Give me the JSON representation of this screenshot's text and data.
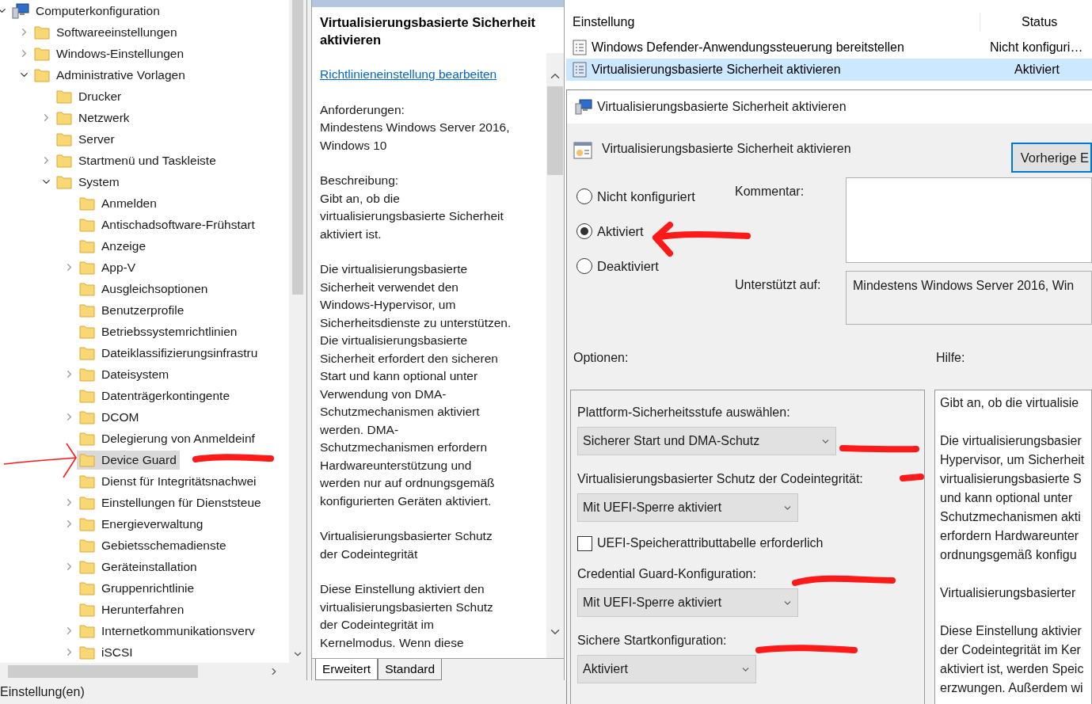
{
  "tree": {
    "items": [
      {
        "label": "Computerkonfiguration",
        "kind": "computer",
        "expanded": true,
        "selected": false,
        "children": [
          {
            "label": "Softwareeinstellungen",
            "kind": "folder",
            "expanded": false,
            "selected": false
          },
          {
            "label": "Windows-Einstellungen",
            "kind": "folder",
            "expanded": false,
            "selected": false
          },
          {
            "label": "Administrative Vorlagen",
            "kind": "folder",
            "expanded": true,
            "selected": false,
            "children": [
              {
                "label": "Drucker",
                "kind": "folder",
                "selected": false
              },
              {
                "label": "Netzwerk",
                "kind": "folder",
                "expanded": false,
                "selected": false
              },
              {
                "label": "Server",
                "kind": "folder",
                "selected": false
              },
              {
                "label": "Startmenü und Taskleiste",
                "kind": "folder",
                "expanded": false,
                "selected": false
              },
              {
                "label": "System",
                "kind": "folder",
                "expanded": true,
                "selected": false,
                "children": [
                  {
                    "label": "Anmelden",
                    "kind": "folder",
                    "selected": false
                  },
                  {
                    "label": "Antischadsoftware-Frühstart",
                    "kind": "folder",
                    "selected": false
                  },
                  {
                    "label": "Anzeige",
                    "kind": "folder",
                    "selected": false
                  },
                  {
                    "label": "App-V",
                    "kind": "folder",
                    "expanded": false,
                    "selected": false
                  },
                  {
                    "label": "Ausgleichsoptionen",
                    "kind": "folder",
                    "selected": false
                  },
                  {
                    "label": "Benutzerprofile",
                    "kind": "folder",
                    "selected": false
                  },
                  {
                    "label": "Betriebssystemrichtlinien",
                    "kind": "folder",
                    "selected": false
                  },
                  {
                    "label": "Dateiklassifizierungsinfrastru",
                    "kind": "folder",
                    "selected": false
                  },
                  {
                    "label": "Dateisystem",
                    "kind": "folder",
                    "expanded": false,
                    "selected": false
                  },
                  {
                    "label": "Datenträgerkontingente",
                    "kind": "folder",
                    "selected": false
                  },
                  {
                    "label": "DCOM",
                    "kind": "folder",
                    "expanded": false,
                    "selected": false
                  },
                  {
                    "label": "Delegierung von Anmeldeinf",
                    "kind": "folder",
                    "selected": false
                  },
                  {
                    "label": "Device Guard",
                    "kind": "folder",
                    "selected": true
                  },
                  {
                    "label": "Dienst für Integritätsnachwei",
                    "kind": "folder",
                    "selected": false
                  },
                  {
                    "label": "Einstellungen für Dienststeue",
                    "kind": "folder",
                    "expanded": false,
                    "selected": false
                  },
                  {
                    "label": "Energieverwaltung",
                    "kind": "folder",
                    "expanded": false,
                    "selected": false
                  },
                  {
                    "label": "Gebietsschemadienste",
                    "kind": "folder",
                    "selected": false
                  },
                  {
                    "label": "Geräteinstallation",
                    "kind": "folder",
                    "expanded": false,
                    "selected": false
                  },
                  {
                    "label": "Gruppenrichtlinie",
                    "kind": "folder",
                    "selected": false
                  },
                  {
                    "label": "Herunterfahren",
                    "kind": "folder",
                    "selected": false
                  },
                  {
                    "label": "Internetkommunikationsverv",
                    "kind": "folder",
                    "expanded": false,
                    "selected": false
                  },
                  {
                    "label": "iSCSI",
                    "kind": "folder",
                    "expanded": false,
                    "selected": false
                  }
                ]
              }
            ]
          }
        ]
      }
    ]
  },
  "status_bar": "Einstellung(en)",
  "explain": {
    "title": "Virtualisierungsbasierte Sicherheit aktivieren",
    "link": "Richtlinieneinstellung bearbeiten",
    "paragraphs": [
      "Anforderungen:\nMindestens Windows Server 2016,\nWindows 10",
      "Beschreibung:\nGibt an, ob die\nvirtualisierungsbasierte Sicherheit\naktiviert ist.",
      "Die virtualisierungsbasierte\nSicherheit verwendet den\nWindows-Hypervisor, um\nSicherheitsdienste zu unterstützen.\nDie virtualisierungsbasierte\nSicherheit erfordert den sicheren\nStart und kann optional unter\nVerwendung von DMA-\nSchutzmechanismen aktiviert\nwerden. DMA-\nSchutzmechanismen erfordern\nHardwareunterstützung und\nwerden nur auf ordnungsgemäß\nkonfigurierten Geräten aktiviert.",
      "Virtualisierungsbasierter Schutz\nder Codeintegrität",
      "Diese Einstellung aktiviert den\nvirtualisierungsbasierten Schutz\nder Codeintegrität im\nKernelmodus. Wenn diese"
    ],
    "tabs": [
      {
        "label": "Erweitert",
        "selected": true
      },
      {
        "label": "Standard",
        "selected": false
      }
    ]
  },
  "settings_list": {
    "columns": [
      "Einstellung",
      "Status"
    ],
    "rows": [
      {
        "name": "Windows Defender-Anwendungssteuerung bereitstellen",
        "status": "Nicht konfiguri…",
        "selected": false
      },
      {
        "name": "Virtualisierungsbasierte Sicherheit aktivieren",
        "status": "Aktiviert",
        "selected": true
      }
    ]
  },
  "dialog": {
    "title": "Virtualisierungsbasierte Sicherheit aktivieren",
    "setting_name": "Virtualisierungsbasierte Sicherheit aktivieren",
    "previous_button": "Vorherige E",
    "states": [
      {
        "label": "Nicht konfiguriert",
        "selected": false
      },
      {
        "label": "Aktiviert",
        "selected": true
      },
      {
        "label": "Deaktiviert",
        "selected": false
      }
    ],
    "comment_label": "Kommentar:",
    "supported_label": "Unterstützt auf:",
    "supported_value": "Mindestens Windows Server 2016, Win",
    "options_label": "Optionen:",
    "help_label": "Hilfe:",
    "options": [
      {
        "kind": "label",
        "text": "Plattform-Sicherheitsstufe auswählen:"
      },
      {
        "kind": "dropdown",
        "value": "Sicherer Start und DMA-Schutz"
      },
      {
        "kind": "label",
        "text": "Virtualisierungsbasierter Schutz der Codeintegrität:"
      },
      {
        "kind": "dropdown",
        "value": "Mit UEFI-Sperre aktiviert"
      },
      {
        "kind": "checkbox",
        "label": "UEFI-Speicherattributtabelle erforderlich",
        "checked": false
      },
      {
        "kind": "label",
        "text": "Credential Guard-Konfiguration:"
      },
      {
        "kind": "dropdown",
        "value": "Mit UEFI-Sperre aktiviert"
      },
      {
        "kind": "label",
        "text": "Sichere Startkonfiguration:"
      },
      {
        "kind": "dropdown",
        "value": "Aktiviert"
      }
    ],
    "help_paragraphs": [
      "Gibt an, ob die virtualisie",
      "Die virtualisierungsbasier\nHypervisor, um Sicherheit\nvirtualisierungsbasierte S\nund kann optional unter\nSchutzmechanismen akti\nerfordern Hardwareunter\nordnungsgemäß konfigu",
      "Virtualisierungsbasierter",
      "Diese Einstellung aktivier\nder Codeintegrität im Ker\naktiviert ist, werden Speic\nerzwungen. Außerdem wi"
    ]
  }
}
